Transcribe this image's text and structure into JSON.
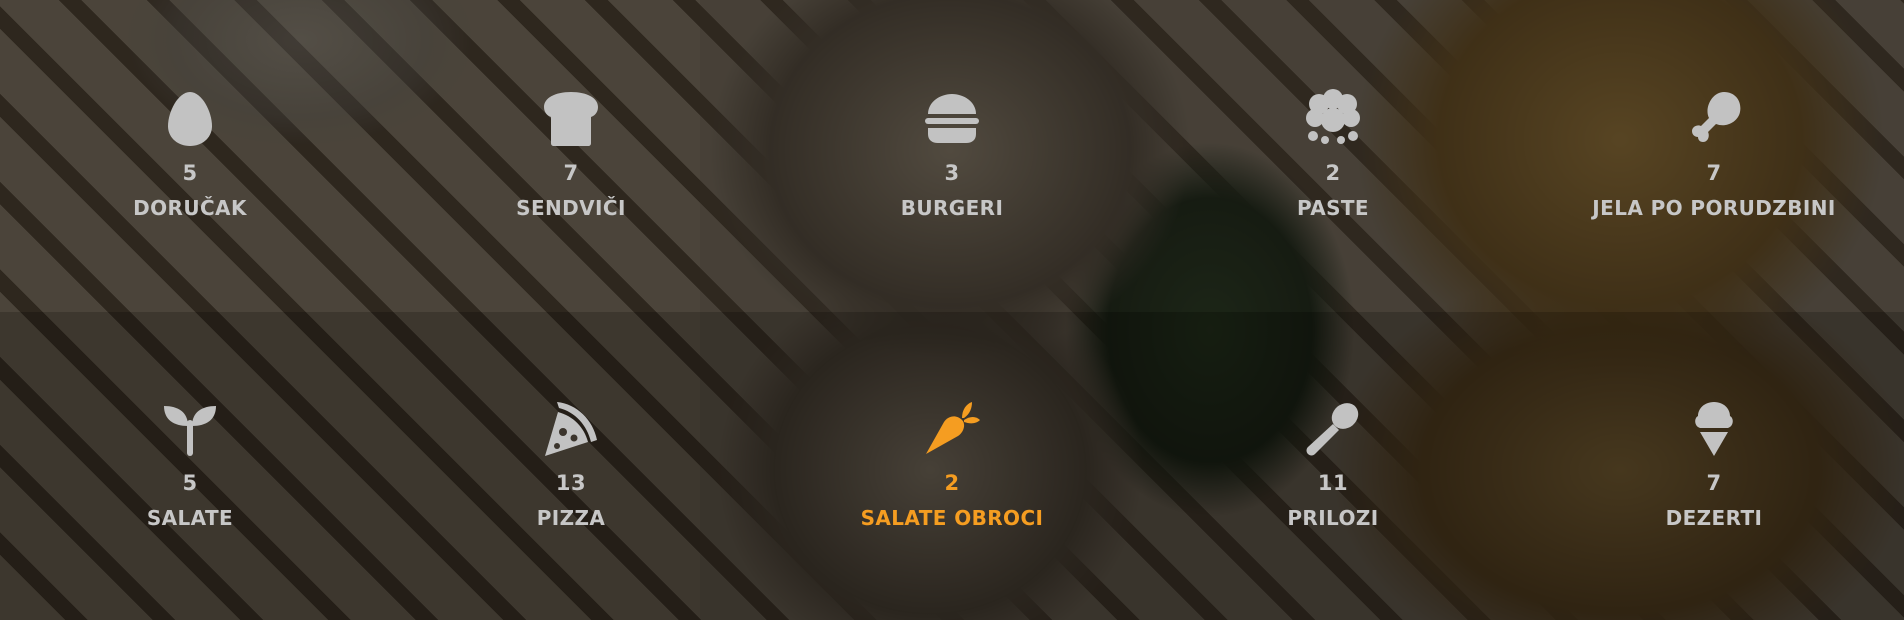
{
  "colors": {
    "text": "#c7c7c7",
    "icon": "#c2c2c2",
    "active": "#f59d21"
  },
  "categories": [
    {
      "label": "DORUČAK",
      "count": "5",
      "icon": "egg-icon"
    },
    {
      "label": "SENDVIČI",
      "count": "7",
      "icon": "bread-icon"
    },
    {
      "label": "BURGERI",
      "count": "3",
      "icon": "burger-icon"
    },
    {
      "label": "PASTE",
      "count": "2",
      "icon": "pasta-icon"
    },
    {
      "label": "JELA PO PORUDZBINI",
      "count": "7",
      "icon": "drumstick-icon"
    },
    {
      "label": "SALATE",
      "count": "5",
      "icon": "sprout-icon"
    },
    {
      "label": "PIZZA",
      "count": "13",
      "icon": "pizza-icon"
    },
    {
      "label": "SALATE OBROCI",
      "count": "2",
      "icon": "carrot-icon",
      "active": true
    },
    {
      "label": "PRILOZI",
      "count": "11",
      "icon": "spoon-icon"
    },
    {
      "label": "DEZERTI",
      "count": "7",
      "icon": "ice-cream-icon"
    }
  ]
}
